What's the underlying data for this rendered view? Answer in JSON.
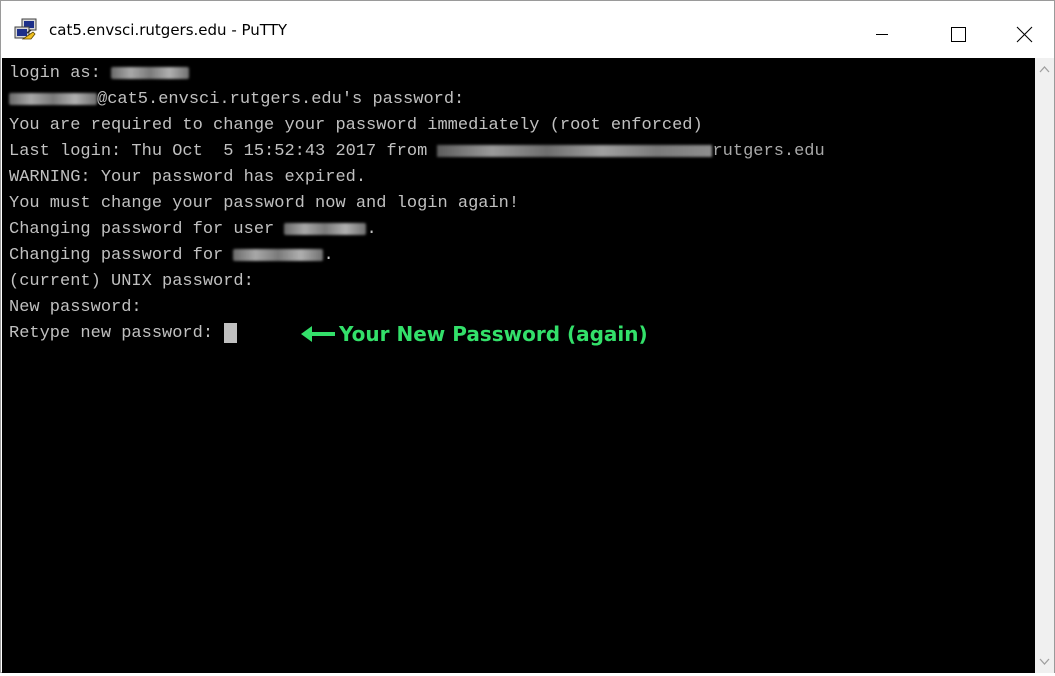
{
  "window": {
    "title": "cat5.envsci.rutgers.edu - PuTTY",
    "icons": {
      "app": "putty-icon",
      "minimize": "minimize-icon",
      "maximize": "maximize-icon",
      "close": "close-icon"
    }
  },
  "terminal": {
    "lines": {
      "l0": "login as: ",
      "l1_post": "@cat5.envsci.rutgers.edu's password:",
      "l2": "You are required to change your password immediately (root enforced)",
      "l3_pre": "Last login: Thu Oct  5 15:52:43 2017 from ",
      "l3_tail": "rutgers.edu",
      "l4": "WARNING: Your password has expired.",
      "l5": "You must change your password now and login again!",
      "l6_pre": "Changing password for user ",
      "l6_post": ".",
      "l7_pre": "Changing password for ",
      "l7_post": ".",
      "l8": "(current) UNIX password:",
      "l9": "New password:",
      "l10": "Retype new password: "
    },
    "annotation": "Your New Password (again)",
    "colors": {
      "background": "#000000",
      "text": "#c0c0c0",
      "annotation": "#33e06a"
    }
  },
  "scrollbar": {
    "icons": {
      "up": "scroll-up-icon",
      "down": "scroll-down-icon"
    }
  }
}
